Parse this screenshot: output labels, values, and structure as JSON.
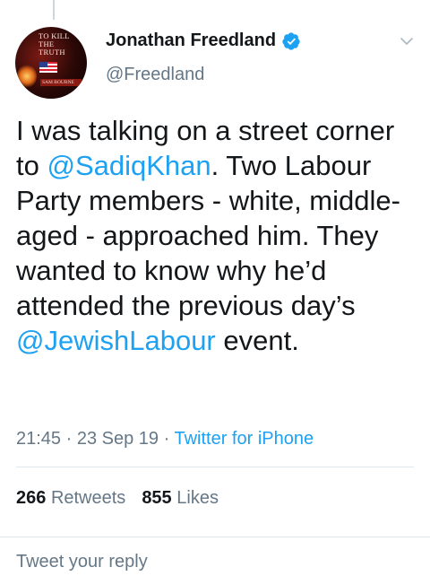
{
  "author": {
    "name": "Jonathan Freedland",
    "handle": "@Freedland",
    "avatar_text": {
      "title": "TO KILL THE TRUTH",
      "author": "SAM BOURNE"
    }
  },
  "tweet": {
    "text_before": "I was talking on a street corner to ",
    "mention_1": "@SadiqKhan",
    "text_middle": ". Two Labour Party members - white, middle-aged - approached him. They wanted to know why he’d attended the previous day’s ",
    "mention_2": "@JewishLabour",
    "text_after": " event."
  },
  "meta": {
    "time": "21:45",
    "date": "23 Sep 19",
    "separator": " · ",
    "source": "Twitter for iPhone"
  },
  "stats": {
    "retweets_count": "266",
    "retweets_label": "Retweets",
    "likes_count": "855",
    "likes_label": "Likes"
  },
  "reply": {
    "placeholder": "Tweet your reply"
  },
  "colors": {
    "link": "#1da1f2",
    "secondary": "#657786",
    "divider": "#e1e8ed"
  },
  "icons": [
    "verified-badge-icon",
    "chevron-down-icon"
  ]
}
